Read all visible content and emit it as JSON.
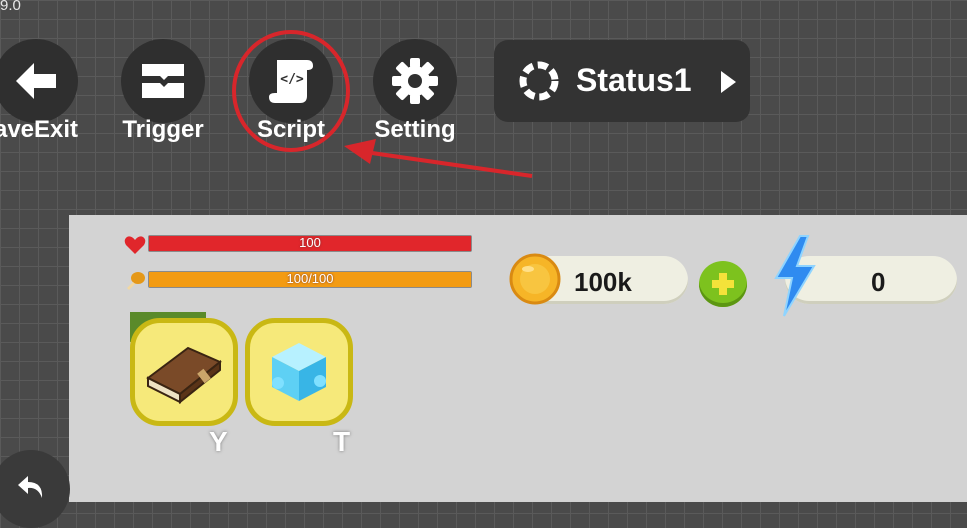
{
  "version": "9.0",
  "toolbar": {
    "save_exit_label": "aveExit",
    "trigger_label": "Trigger",
    "script_label": "Script",
    "setting_label": "Setting"
  },
  "status": {
    "label": "Status1"
  },
  "hud": {
    "health": {
      "text": "100",
      "fraction": 1.0,
      "color": "#e1262b"
    },
    "stamina": {
      "text": "100/100",
      "fraction": 1.0,
      "color": "#f39b12"
    },
    "coins": "100k",
    "energy": "0"
  },
  "items": [
    {
      "icon": "book-icon",
      "key": "Y"
    },
    {
      "icon": "ice-cube-icon",
      "key": "T"
    }
  ],
  "colors": {
    "highlight_red": "#d8262b",
    "item_yellow": "#f6e97a",
    "plus_green": "#7dc21e",
    "bolt_blue": "#2f8bf0",
    "coin_gold": "#f0a81c"
  }
}
